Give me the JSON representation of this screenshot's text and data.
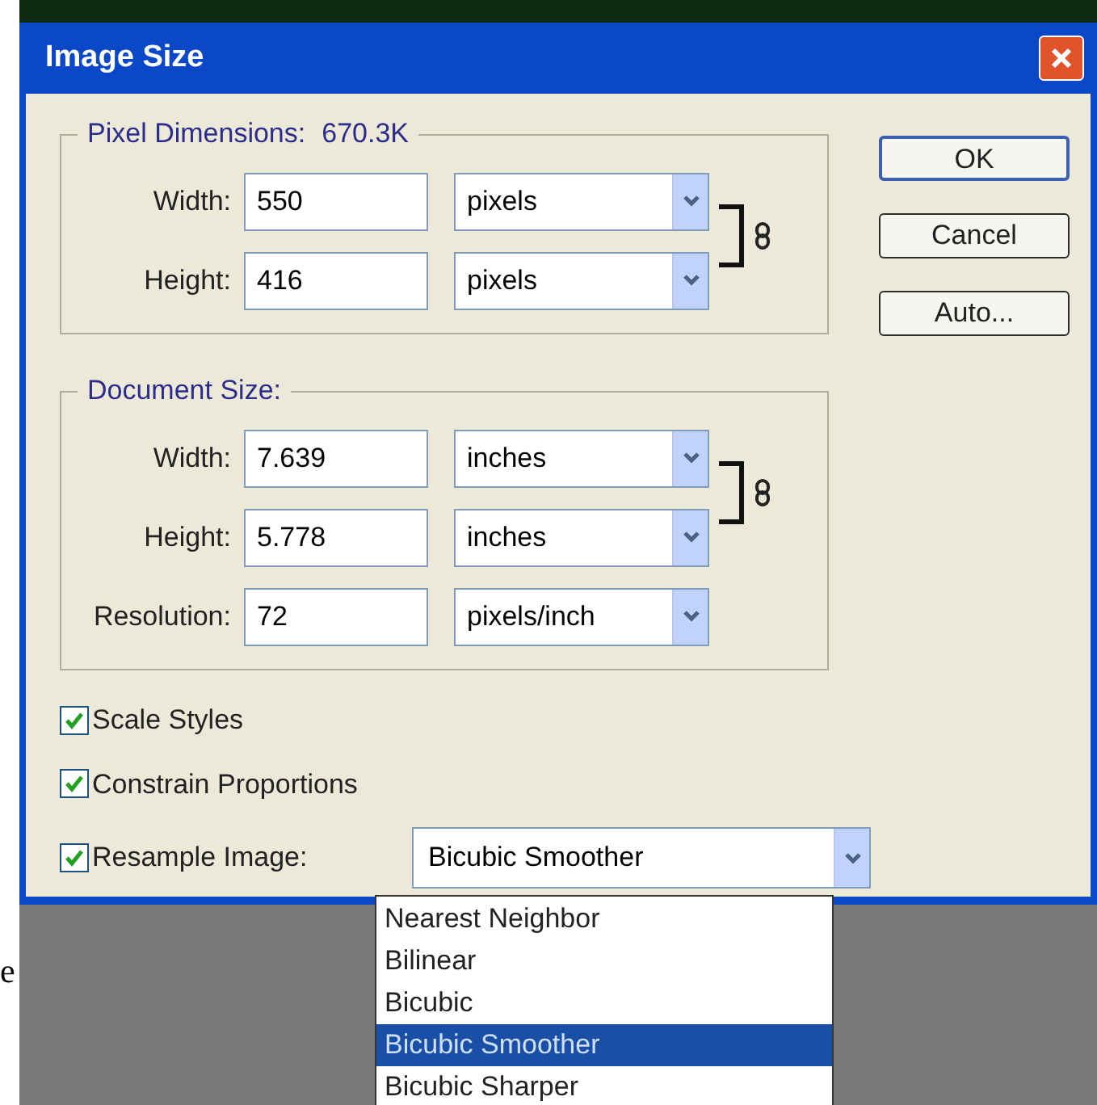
{
  "window": {
    "title": "Image Size"
  },
  "pixel_dimensions": {
    "legend": "Pixel Dimensions:",
    "value": "670.3K",
    "fields": [
      {
        "label": "Width:",
        "value": "550",
        "unit": "pixels"
      },
      {
        "label": "Height:",
        "value": "416",
        "unit": "pixels"
      }
    ]
  },
  "document_size": {
    "legend": "Document Size:",
    "fields": [
      {
        "label": "Width:",
        "value": "7.639",
        "unit": "inches"
      },
      {
        "label": "Height:",
        "value": "5.778",
        "unit": "inches"
      },
      {
        "label": "Resolution:",
        "value": "72",
        "unit": "pixels/inch"
      }
    ]
  },
  "buttons": [
    {
      "label": "OK",
      "default": true
    },
    {
      "label": "Cancel",
      "default": false
    },
    {
      "label": "Auto...",
      "default": false
    }
  ],
  "options": [
    {
      "label": "Scale Styles",
      "checked": true
    },
    {
      "label": "Constrain Proportions",
      "checked": true
    }
  ],
  "resample": {
    "label": "Resample Image:",
    "checked": true,
    "value": "Bicubic Smoother",
    "options": [
      {
        "label": "Nearest Neighbor",
        "selected": false
      },
      {
        "label": "Bilinear",
        "selected": false
      },
      {
        "label": "Bicubic",
        "selected": false
      },
      {
        "label": "Bicubic Smoother",
        "selected": true
      },
      {
        "label": "Bicubic Sharper",
        "selected": false
      }
    ]
  },
  "margin_text": "e"
}
